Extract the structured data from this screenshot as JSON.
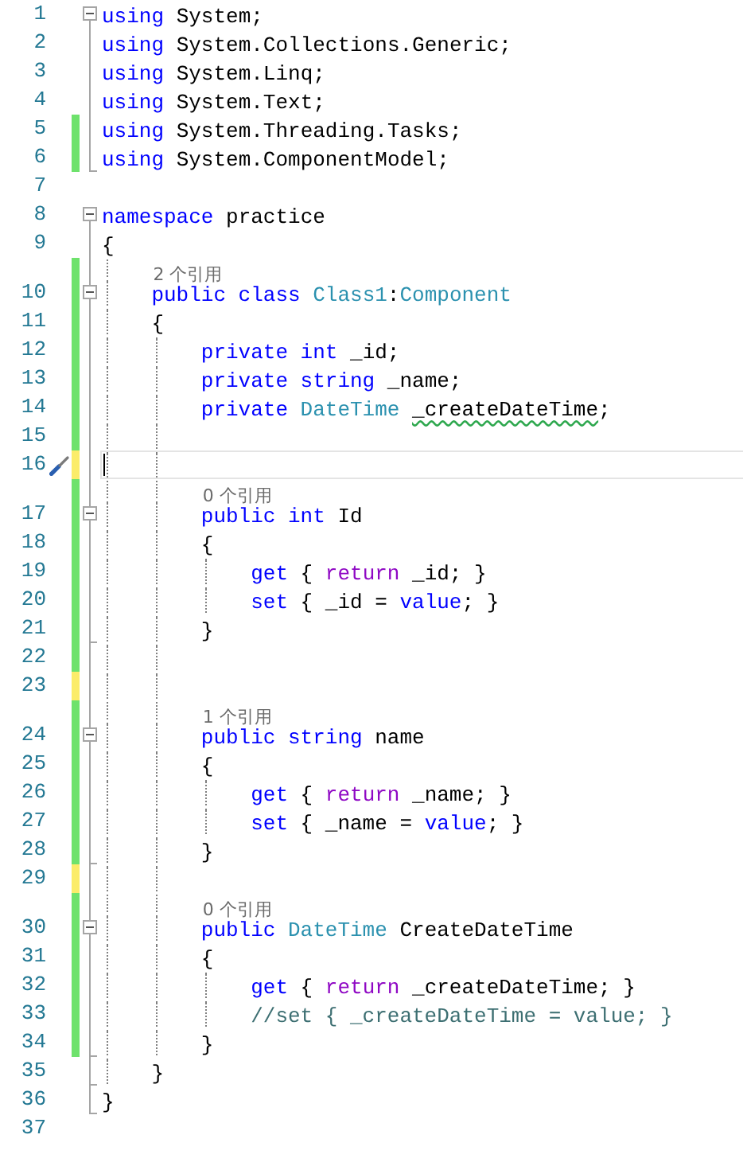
{
  "editor": {
    "lines": [
      {
        "number": "1",
        "fold_toggle": {
          "expanded": true
        },
        "region_end": false,
        "current": false,
        "tokens": [
          {
            "text": "using",
            "kind": "keyword"
          },
          {
            "text": " System;",
            "kind": "plain"
          }
        ]
      },
      {
        "number": "2",
        "region_end": false,
        "current": false,
        "tokens": [
          {
            "text": "using",
            "kind": "keyword"
          },
          {
            "text": " System.Collections.Generic;",
            "kind": "plain"
          }
        ]
      },
      {
        "number": "3",
        "region_end": false,
        "current": false,
        "tokens": [
          {
            "text": "using",
            "kind": "keyword"
          },
          {
            "text": " System.Linq;",
            "kind": "plain"
          }
        ]
      },
      {
        "number": "4",
        "region_end": false,
        "current": false,
        "tokens": [
          {
            "text": "using",
            "kind": "keyword"
          },
          {
            "text": " System.Text;",
            "kind": "plain"
          }
        ]
      },
      {
        "number": "5",
        "change": {
          "color": "#6ee26c"
        },
        "region_end": false,
        "current": false,
        "tokens": [
          {
            "text": "using",
            "kind": "keyword"
          },
          {
            "text": " System.Threading.Tasks;",
            "kind": "plain"
          }
        ]
      },
      {
        "number": "6",
        "change": {
          "color": "#6ee26c"
        },
        "region_end": true,
        "current": false,
        "tokens": [
          {
            "text": "using",
            "kind": "keyword"
          },
          {
            "text": " System.ComponentModel;",
            "kind": "plain"
          }
        ]
      },
      {
        "number": "7",
        "region_end": false,
        "current": false
      },
      {
        "number": "8",
        "fold_toggle": {
          "expanded": true
        },
        "region_end": false,
        "current": false,
        "tokens": [
          {
            "text": "namespace",
            "kind": "keyword"
          },
          {
            "text": " practice",
            "kind": "plain"
          }
        ]
      },
      {
        "number": "9",
        "region_end": false,
        "current": false,
        "tokens": [
          {
            "text": "{",
            "kind": "plain"
          }
        ]
      },
      {
        "number": "10",
        "change": {
          "color": "#6ee26c"
        },
        "fold_toggle": {
          "expanded": true
        },
        "region_end": false,
        "current": false,
        "references": "2 个引用",
        "tokens": [
          {
            "text": "public",
            "kind": "keyword"
          },
          {
            "text": " class",
            "kind": "keyword"
          },
          {
            "text": " Class1",
            "kind": "type"
          },
          {
            "text": ":",
            "kind": "plain"
          },
          {
            "text": "Component",
            "kind": "type"
          }
        ]
      },
      {
        "number": "11",
        "change": {
          "color": "#6ee26c"
        },
        "region_end": false,
        "current": false,
        "tokens": [
          {
            "text": "{",
            "kind": "plain"
          }
        ]
      },
      {
        "number": "12",
        "change": {
          "color": "#6ee26c"
        },
        "region_end": false,
        "current": false,
        "tokens": [
          {
            "text": "private",
            "kind": "keyword"
          },
          {
            "text": " int",
            "kind": "keyword"
          },
          {
            "text": " _id;",
            "kind": "plain"
          }
        ]
      },
      {
        "number": "13",
        "change": {
          "color": "#6ee26c"
        },
        "region_end": false,
        "current": false,
        "tokens": [
          {
            "text": "private",
            "kind": "keyword"
          },
          {
            "text": " string",
            "kind": "keyword"
          },
          {
            "text": " _name;",
            "kind": "plain"
          }
        ]
      },
      {
        "number": "14",
        "change": {
          "color": "#6ee26c"
        },
        "region_end": false,
        "current": false,
        "tokens": [
          {
            "text": "private",
            "kind": "keyword"
          },
          {
            "text": " DateTime ",
            "kind": "type"
          },
          {
            "text": "_createDateTime",
            "kind": "plain",
            "warning": true
          },
          {
            "text": ";",
            "kind": "plain"
          }
        ]
      },
      {
        "number": "15",
        "change": {
          "color": "#6ee26c"
        },
        "region_end": false,
        "current": false
      },
      {
        "number": "16",
        "change": {
          "color": "#fbec6a"
        },
        "region_end": false,
        "current": true
      },
      {
        "number": "17",
        "change": {
          "color": "#6ee26c"
        },
        "fold_toggle": {
          "expanded": true
        },
        "region_end": false,
        "current": false,
        "references": "0 个引用",
        "tokens": [
          {
            "text": "public",
            "kind": "keyword"
          },
          {
            "text": " int",
            "kind": "keyword"
          },
          {
            "text": " Id",
            "kind": "plain"
          }
        ]
      },
      {
        "number": "18",
        "change": {
          "color": "#6ee26c"
        },
        "region_end": false,
        "current": false,
        "tokens": [
          {
            "text": "{",
            "kind": "plain"
          }
        ]
      },
      {
        "number": "19",
        "change": {
          "color": "#6ee26c"
        },
        "region_end": false,
        "current": false,
        "tokens": [
          {
            "text": "get",
            "kind": "keyword"
          },
          {
            "text": " {",
            "kind": "plain"
          },
          {
            "text": " return",
            "kind": "control"
          },
          {
            "text": " _id; }",
            "kind": "plain"
          }
        ]
      },
      {
        "number": "20",
        "change": {
          "color": "#6ee26c"
        },
        "region_end": false,
        "current": false,
        "tokens": [
          {
            "text": "set",
            "kind": "keyword"
          },
          {
            "text": " { _id =",
            "kind": "plain"
          },
          {
            "text": " value",
            "kind": "keyword"
          },
          {
            "text": "; }",
            "kind": "plain"
          }
        ]
      },
      {
        "number": "21",
        "change": {
          "color": "#6ee26c"
        },
        "region_end": true,
        "current": false,
        "tokens": [
          {
            "text": "}",
            "kind": "plain"
          }
        ]
      },
      {
        "number": "22",
        "change": {
          "color": "#6ee26c"
        },
        "region_end": false,
        "current": false
      },
      {
        "number": "23",
        "change": {
          "color": "#fbec6a"
        },
        "region_end": false,
        "current": false
      },
      {
        "number": "24",
        "change": {
          "color": "#6ee26c"
        },
        "fold_toggle": {
          "expanded": true
        },
        "region_end": false,
        "current": false,
        "references": "1 个引用",
        "tokens": [
          {
            "text": "public",
            "kind": "keyword"
          },
          {
            "text": " string",
            "kind": "keyword"
          },
          {
            "text": " name",
            "kind": "plain"
          }
        ]
      },
      {
        "number": "25",
        "change": {
          "color": "#6ee26c"
        },
        "region_end": false,
        "current": false,
        "tokens": [
          {
            "text": "{",
            "kind": "plain"
          }
        ]
      },
      {
        "number": "26",
        "change": {
          "color": "#6ee26c"
        },
        "region_end": false,
        "current": false,
        "tokens": [
          {
            "text": "get",
            "kind": "keyword"
          },
          {
            "text": " {",
            "kind": "plain"
          },
          {
            "text": " return",
            "kind": "control"
          },
          {
            "text": " _name; }",
            "kind": "plain"
          }
        ]
      },
      {
        "number": "27",
        "change": {
          "color": "#6ee26c"
        },
        "region_end": false,
        "current": false,
        "tokens": [
          {
            "text": "set",
            "kind": "keyword"
          },
          {
            "text": " { _name =",
            "kind": "plain"
          },
          {
            "text": " value",
            "kind": "keyword"
          },
          {
            "text": "; }",
            "kind": "plain"
          }
        ]
      },
      {
        "number": "28",
        "change": {
          "color": "#6ee26c"
        },
        "region_end": true,
        "current": false,
        "tokens": [
          {
            "text": "}",
            "kind": "plain"
          }
        ]
      },
      {
        "number": "29",
        "change": {
          "color": "#fbec6a"
        },
        "region_end": false,
        "current": false
      },
      {
        "number": "30",
        "change": {
          "color": "#6ee26c"
        },
        "fold_toggle": {
          "expanded": true
        },
        "region_end": false,
        "current": false,
        "references": "0 个引用",
        "tokens": [
          {
            "text": "public",
            "kind": "keyword"
          },
          {
            "text": " DateTime",
            "kind": "type"
          },
          {
            "text": " CreateDateTime",
            "kind": "plain"
          }
        ]
      },
      {
        "number": "31",
        "change": {
          "color": "#6ee26c"
        },
        "region_end": false,
        "current": false,
        "tokens": [
          {
            "text": "{",
            "kind": "plain"
          }
        ]
      },
      {
        "number": "32",
        "change": {
          "color": "#6ee26c"
        },
        "region_end": false,
        "current": false,
        "tokens": [
          {
            "text": "get",
            "kind": "keyword"
          },
          {
            "text": " {",
            "kind": "plain"
          },
          {
            "text": " return",
            "kind": "control"
          },
          {
            "text": " _createDateTime; }",
            "kind": "plain"
          }
        ]
      },
      {
        "number": "33",
        "change": {
          "color": "#6ee26c"
        },
        "region_end": false,
        "current": false,
        "tokens": [
          {
            "text": "//set { _createDateTime = value; }",
            "kind": "comment"
          }
        ]
      },
      {
        "number": "34",
        "change": {
          "color": "#6ee26c"
        },
        "region_end": true,
        "current": false,
        "tokens": [
          {
            "text": "}",
            "kind": "plain"
          }
        ]
      },
      {
        "number": "35",
        "region_end": true,
        "current": false,
        "tokens": [
          {
            "text": "}",
            "kind": "plain"
          }
        ]
      },
      {
        "number": "36",
        "region_end": true,
        "current": false,
        "tokens": [
          {
            "text": "}",
            "kind": "plain"
          }
        ]
      },
      {
        "number": "37",
        "region_end": false,
        "current": false
      }
    ]
  }
}
